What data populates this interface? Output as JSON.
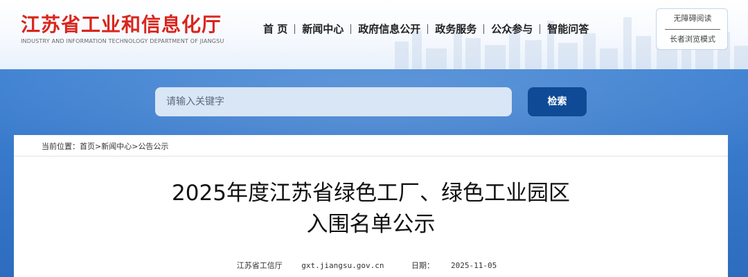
{
  "header": {
    "site_name": "江苏省工业和信息化厅",
    "site_name_en": "INDUSTRY AND INFORMATION TECHNOLOGY DEPARTMENT OF JIANGSU",
    "brand_color": "#d9251d",
    "nav": [
      "首 页",
      "新闻中心",
      "政府信息公开",
      "政务服务",
      "公众参与",
      "智能问答"
    ],
    "accessibility": {
      "barrier_free": "无障碍阅读",
      "elderly_mode": "长者浏览模式"
    }
  },
  "search": {
    "placeholder": "请输入关键字",
    "button_label": "检索",
    "button_color": "#0f4a96"
  },
  "breadcrumb": {
    "prefix": "当前位置：",
    "items": [
      "首页",
      "新闻中心",
      "公告公示"
    ],
    "separator": ">"
  },
  "article": {
    "title_line1": "2025年度江苏省绿色工厂、绿色工业园区",
    "title_line2": "入围名单公示",
    "source": "江苏省工信厅",
    "site": "gxt.jiangsu.gov.cn",
    "date_label": "日期：",
    "date": "2025-11-05"
  }
}
